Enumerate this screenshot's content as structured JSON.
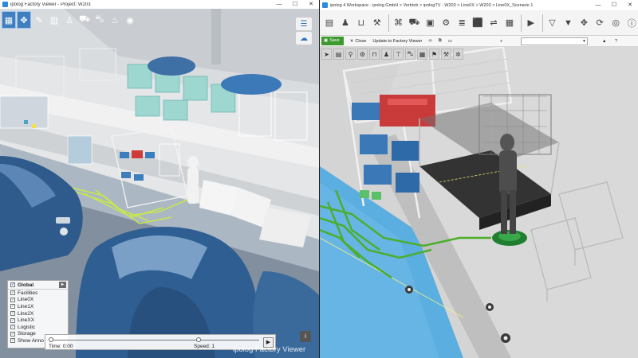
{
  "left_window": {
    "title": "ipolog Factory Viewer - Project: W203",
    "controls": {
      "minimize": "—",
      "maximize": "☐",
      "close": "✕"
    },
    "toolbar": [
      {
        "name": "grid-view-icon",
        "glyph": "▦"
      },
      {
        "name": "move-icon",
        "glyph": "✥"
      },
      {
        "name": "pin-icon",
        "glyph": "✎"
      },
      {
        "name": "layout-icon",
        "glyph": "▥"
      },
      {
        "name": "walk-icon",
        "glyph": "♙"
      },
      {
        "name": "forklift-icon",
        "glyph": "⛟"
      },
      {
        "name": "car-icon",
        "glyph": "⛍"
      },
      {
        "name": "fire-icon",
        "glyph": "♨"
      },
      {
        "name": "camera-icon",
        "glyph": "◉"
      }
    ],
    "side_tools": [
      {
        "name": "settings-sliders-icon",
        "glyph": "☰"
      },
      {
        "name": "cloud-icon",
        "glyph": "☁"
      }
    ],
    "layers": {
      "header": "Global",
      "expand_glyph": "▸",
      "items": [
        "Facilities",
        "Line0X",
        "Line1X",
        "Line2X",
        "LineXX",
        "Logistic",
        "Storage",
        "Show Anno"
      ]
    },
    "timebar": {
      "time": "Time: 0:00",
      "speed": "Speed: 1",
      "play_glyph": "▶"
    },
    "watermark": "ipolog Factory Viewer",
    "info_glyph": "i"
  },
  "right_window": {
    "title": "ipolog 4 Workspace - ipolog GmbH > Vertrieb > ipologTV - W203 > Line0X > W203 > Line0X_Scenario 1",
    "controls": {
      "minimize": "—",
      "maximize": "☐",
      "close": "✕"
    },
    "ribbon": [
      {
        "name": "shelf-icon",
        "glyph": "▤"
      },
      {
        "name": "person-icon",
        "glyph": "♟"
      },
      {
        "name": "bin-icon",
        "glyph": "⊔"
      },
      {
        "name": "tool-icon",
        "glyph": "⚒"
      },
      {
        "name": "tag-icon",
        "glyph": "⌘"
      },
      {
        "name": "truck-icon",
        "glyph": "⛟"
      },
      {
        "name": "box-icon",
        "glyph": "▣"
      },
      {
        "name": "forklift-icon",
        "glyph": "⚙"
      },
      {
        "name": "layers-icon",
        "glyph": "≣"
      },
      {
        "name": "cube-icon",
        "glyph": "⬛"
      },
      {
        "name": "route-icon",
        "glyph": "⇌"
      },
      {
        "name": "grid-icon",
        "glyph": "▦"
      },
      {
        "name": "play-icon",
        "glyph": "▶"
      },
      {
        "name": "filter-outline-icon",
        "glyph": "▽"
      },
      {
        "name": "filter-icon",
        "glyph": "▼"
      },
      {
        "name": "move-icon",
        "glyph": "✥"
      },
      {
        "name": "refresh-icon",
        "glyph": "⟳"
      },
      {
        "name": "target-icon",
        "glyph": "◎"
      },
      {
        "name": "info-icon",
        "glyph": "ⓘ"
      }
    ],
    "toolbar2": {
      "save": "Save",
      "close": "Close",
      "update": "Update to Factory Viewer",
      "plus": "+",
      "help": "?"
    },
    "toolbar3": [
      {
        "name": "arrow-icon",
        "glyph": "➤"
      },
      {
        "name": "shelf-icon",
        "glyph": "▤"
      },
      {
        "name": "pin-icon",
        "glyph": "⚲"
      },
      {
        "name": "gear-icon",
        "glyph": "⚙"
      },
      {
        "name": "frame-icon",
        "glyph": "⊓"
      },
      {
        "name": "person-icon",
        "glyph": "♟"
      },
      {
        "name": "table-icon",
        "glyph": "⊤"
      },
      {
        "name": "car-icon",
        "glyph": "⛍"
      },
      {
        "name": "chart-icon",
        "glyph": "▦"
      },
      {
        "name": "flag-icon",
        "glyph": "⚑"
      },
      {
        "name": "tool-icon",
        "glyph": "⚒"
      },
      {
        "name": "settings-icon",
        "glyph": "✲"
      }
    ]
  }
}
